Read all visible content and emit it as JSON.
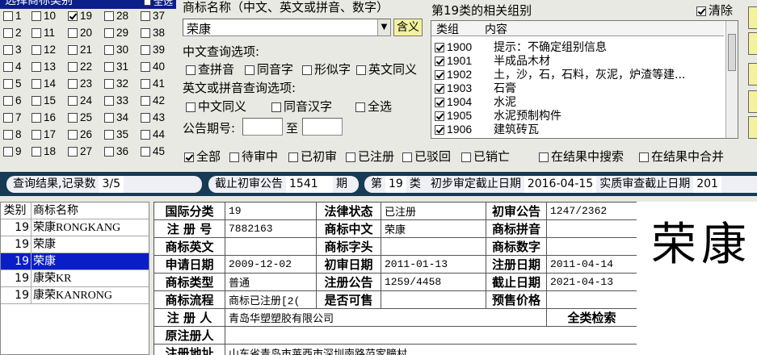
{
  "category_panel": {
    "title": "选择商标类别",
    "select_all": "全选",
    "categories": [
      {
        "n": "1",
        "on": false
      },
      {
        "n": "10",
        "on": false
      },
      {
        "n": "19",
        "on": true
      },
      {
        "n": "28",
        "on": false
      },
      {
        "n": "37",
        "on": false
      },
      {
        "n": "2",
        "on": false
      },
      {
        "n": "11",
        "on": false
      },
      {
        "n": "20",
        "on": false
      },
      {
        "n": "29",
        "on": false
      },
      {
        "n": "38",
        "on": false
      },
      {
        "n": "3",
        "on": false
      },
      {
        "n": "12",
        "on": false
      },
      {
        "n": "21",
        "on": false
      },
      {
        "n": "30",
        "on": false
      },
      {
        "n": "39",
        "on": false
      },
      {
        "n": "4",
        "on": false
      },
      {
        "n": "13",
        "on": false
      },
      {
        "n": "22",
        "on": false
      },
      {
        "n": "31",
        "on": false
      },
      {
        "n": "40",
        "on": false
      },
      {
        "n": "5",
        "on": false
      },
      {
        "n": "14",
        "on": false
      },
      {
        "n": "23",
        "on": false
      },
      {
        "n": "32",
        "on": false
      },
      {
        "n": "41",
        "on": false
      },
      {
        "n": "6",
        "on": false
      },
      {
        "n": "15",
        "on": false
      },
      {
        "n": "24",
        "on": false
      },
      {
        "n": "33",
        "on": false
      },
      {
        "n": "42",
        "on": false
      },
      {
        "n": "7",
        "on": false
      },
      {
        "n": "16",
        "on": false
      },
      {
        "n": "25",
        "on": false
      },
      {
        "n": "34",
        "on": false
      },
      {
        "n": "43",
        "on": false
      },
      {
        "n": "8",
        "on": false
      },
      {
        "n": "17",
        "on": false
      },
      {
        "n": "26",
        "on": false
      },
      {
        "n": "35",
        "on": false
      },
      {
        "n": "44",
        "on": false
      },
      {
        "n": "9",
        "on": false
      },
      {
        "n": "18",
        "on": false
      },
      {
        "n": "27",
        "on": false
      },
      {
        "n": "36",
        "on": false
      },
      {
        "n": "45",
        "on": false
      }
    ]
  },
  "search": {
    "name_label": "商标名称（中文、英文或拼音、数字）",
    "name_value": "荣康",
    "meaning_btn": "含义",
    "cn_options_label": "中文查询选项:",
    "cn_options": [
      "查拼音",
      "同音字",
      "形似字",
      "英文同义"
    ],
    "en_options_label": "英文或拼音查询选项:",
    "en_options": [
      "中文同义",
      "同音汉字",
      "全选"
    ],
    "period_label": "公告期号:",
    "period_to": "至"
  },
  "groups": {
    "title": "第19类的相关组别",
    "clear_label": "清除",
    "clear_checked": true,
    "headers": [
      "类组",
      "内容"
    ],
    "rows": [
      {
        "code": "1900",
        "text": "提示：不确定组别信息"
      },
      {
        "code": "1901",
        "text": "半成品木材"
      },
      {
        "code": "1902",
        "text": "土，沙，石，石料，灰泥，炉渣等建..."
      },
      {
        "code": "1903",
        "text": "石膏"
      },
      {
        "code": "1904",
        "text": "水泥"
      },
      {
        "code": "1905",
        "text": "水泥预制构件"
      },
      {
        "code": "1906",
        "text": "建筑砖瓦"
      }
    ]
  },
  "filters": [
    {
      "label": "全部",
      "on": true
    },
    {
      "label": "待审中",
      "on": false
    },
    {
      "label": "已初审",
      "on": false
    },
    {
      "label": "已注册",
      "on": false
    },
    {
      "label": "已驳回",
      "on": false
    },
    {
      "label": "已销亡",
      "on": false
    },
    {
      "label": "在结果中搜索",
      "on": false
    },
    {
      "label": "在结果中合并",
      "on": false
    }
  ],
  "status": {
    "result_label": "查询结果,记录数",
    "result_value": "3/5",
    "cutoff_label": "截止初审公告",
    "cutoff_value": "1541",
    "cutoff_unit": "期",
    "class_prefix": "第",
    "class_value": "19",
    "class_suffix": "类",
    "prelim_label": "初步审定截止日期",
    "prelim_value": "2016-04-15",
    "substantive_label": "实质审查截止日期",
    "substantive_value": "201"
  },
  "results": {
    "headers": [
      "类别",
      "商标名称"
    ],
    "rows": [
      {
        "cls": "19",
        "name": "荣康RONGKANG",
        "selected": false
      },
      {
        "cls": "19",
        "name": "荣康",
        "selected": false
      },
      {
        "cls": "19",
        "name": "荣康",
        "selected": true
      },
      {
        "cls": "19",
        "name": "康荣KR",
        "selected": false
      },
      {
        "cls": "19",
        "name": "康荣KANRONG",
        "selected": false
      }
    ]
  },
  "detail": {
    "intl_class_k": "国际分类",
    "intl_class_v": "19",
    "legal_status_k": "法律状态",
    "legal_status_v": "已注册",
    "prelim_pub_k": "初审公告",
    "prelim_pub_v": "1247/2362",
    "reg_no_k": "注 册 号",
    "reg_no_v": "7882163",
    "cn_name_k": "商标中文",
    "cn_name_v": "荣康",
    "pinyin_k": "商标拼音",
    "pinyin_v": "",
    "en_name_k": "商标英文",
    "en_name_v": "",
    "initials_k": "商标字头",
    "initials_v": "",
    "digits_k": "商标数字",
    "digits_v": "",
    "apply_date_k": "申请日期",
    "apply_date_v": "2009-12-02",
    "prelim_date_k": "初审日期",
    "prelim_date_v": "2011-01-13",
    "reg_date_k": "注册日期",
    "reg_date_v": "2011-04-14",
    "type_k": "商标类型",
    "type_v": "普通",
    "reg_pub_k": "注册公告",
    "reg_pub_v": "1259/4458",
    "expiry_k": "截止日期",
    "expiry_v": "2021-04-13",
    "flow_k": "商标流程",
    "flow_v": "商标已注册[2(",
    "sellable_k": "是否可售",
    "sellable_v": "",
    "presale_k": "预售价格",
    "presale_v": "",
    "registrant_k": "注 册 人",
    "registrant_v": "青岛华塑塑胶有限公司",
    "search_all": "全类检索",
    "orig_registrant_k": "原注册人",
    "orig_registrant_v": "",
    "address_k": "注册地址",
    "address_v": "山东省青岛市莱西市深圳南路范家疃村"
  },
  "big_name": "荣康"
}
